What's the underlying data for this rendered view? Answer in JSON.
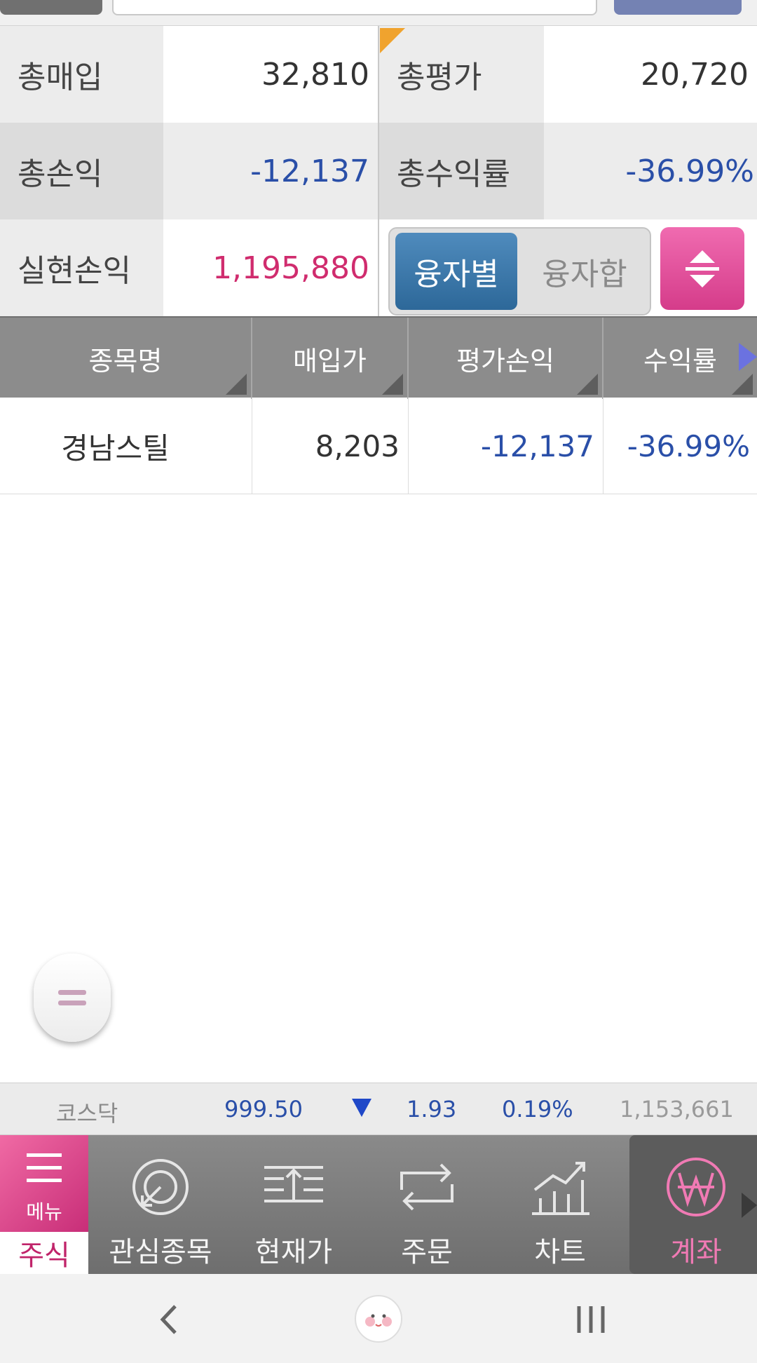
{
  "summary": {
    "total_purchase_label": "총매입",
    "total_purchase_value": "32,810",
    "total_eval_label": "총평가",
    "total_eval_value": "20,720",
    "total_pl_label": "총손익",
    "total_pl_value": "-12,137",
    "total_return_label": "총수익률",
    "total_return_value": "-36.99%",
    "realized_pl_label": "실현손익",
    "realized_pl_value": "1,195,880"
  },
  "toggle": {
    "by_loan": "융자별",
    "loan_sum": "융자합"
  },
  "table": {
    "headers": [
      "종목명",
      "매입가",
      "평가손익",
      "수익률"
    ],
    "rows": [
      {
        "name": "경남스틸",
        "buy_price": "8,203",
        "eval_pl": "-12,137",
        "return": "-36.99%"
      }
    ]
  },
  "ticker": {
    "index_name": "코스닥",
    "value": "999.50",
    "change": "1.93",
    "change_pct": "0.19%",
    "volume": "1,153,661"
  },
  "nav": {
    "menu_label": "메뉴",
    "stock_label": "주식",
    "items": [
      "관심종목",
      "현재가",
      "주문",
      "차트",
      "계좌"
    ]
  },
  "colors": {
    "negative": "#2a4fa8",
    "positive": "#d02c6e",
    "accent": "#e0448e",
    "toggle_active": "#3b78aa"
  }
}
